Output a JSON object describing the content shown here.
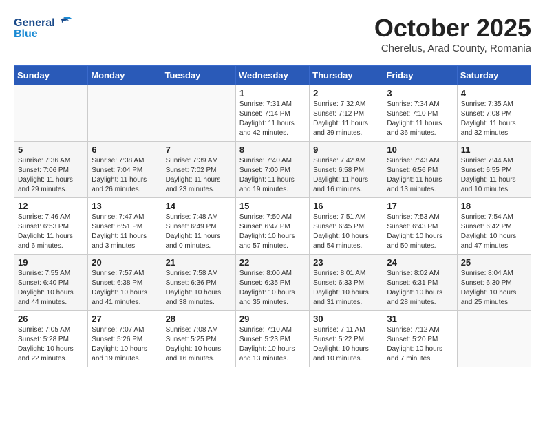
{
  "header": {
    "logo_line1": "General",
    "logo_line2": "Blue",
    "month": "October 2025",
    "location": "Cherelus, Arad County, Romania"
  },
  "weekdays": [
    "Sunday",
    "Monday",
    "Tuesday",
    "Wednesday",
    "Thursday",
    "Friday",
    "Saturday"
  ],
  "weeks": [
    [
      {
        "day": "",
        "info": ""
      },
      {
        "day": "",
        "info": ""
      },
      {
        "day": "",
        "info": ""
      },
      {
        "day": "1",
        "info": "Sunrise: 7:31 AM\nSunset: 7:14 PM\nDaylight: 11 hours\nand 42 minutes."
      },
      {
        "day": "2",
        "info": "Sunrise: 7:32 AM\nSunset: 7:12 PM\nDaylight: 11 hours\nand 39 minutes."
      },
      {
        "day": "3",
        "info": "Sunrise: 7:34 AM\nSunset: 7:10 PM\nDaylight: 11 hours\nand 36 minutes."
      },
      {
        "day": "4",
        "info": "Sunrise: 7:35 AM\nSunset: 7:08 PM\nDaylight: 11 hours\nand 32 minutes."
      }
    ],
    [
      {
        "day": "5",
        "info": "Sunrise: 7:36 AM\nSunset: 7:06 PM\nDaylight: 11 hours\nand 29 minutes."
      },
      {
        "day": "6",
        "info": "Sunrise: 7:38 AM\nSunset: 7:04 PM\nDaylight: 11 hours\nand 26 minutes."
      },
      {
        "day": "7",
        "info": "Sunrise: 7:39 AM\nSunset: 7:02 PM\nDaylight: 11 hours\nand 23 minutes."
      },
      {
        "day": "8",
        "info": "Sunrise: 7:40 AM\nSunset: 7:00 PM\nDaylight: 11 hours\nand 19 minutes."
      },
      {
        "day": "9",
        "info": "Sunrise: 7:42 AM\nSunset: 6:58 PM\nDaylight: 11 hours\nand 16 minutes."
      },
      {
        "day": "10",
        "info": "Sunrise: 7:43 AM\nSunset: 6:56 PM\nDaylight: 11 hours\nand 13 minutes."
      },
      {
        "day": "11",
        "info": "Sunrise: 7:44 AM\nSunset: 6:55 PM\nDaylight: 11 hours\nand 10 minutes."
      }
    ],
    [
      {
        "day": "12",
        "info": "Sunrise: 7:46 AM\nSunset: 6:53 PM\nDaylight: 11 hours\nand 6 minutes."
      },
      {
        "day": "13",
        "info": "Sunrise: 7:47 AM\nSunset: 6:51 PM\nDaylight: 11 hours\nand 3 minutes."
      },
      {
        "day": "14",
        "info": "Sunrise: 7:48 AM\nSunset: 6:49 PM\nDaylight: 11 hours\nand 0 minutes."
      },
      {
        "day": "15",
        "info": "Sunrise: 7:50 AM\nSunset: 6:47 PM\nDaylight: 10 hours\nand 57 minutes."
      },
      {
        "day": "16",
        "info": "Sunrise: 7:51 AM\nSunset: 6:45 PM\nDaylight: 10 hours\nand 54 minutes."
      },
      {
        "day": "17",
        "info": "Sunrise: 7:53 AM\nSunset: 6:43 PM\nDaylight: 10 hours\nand 50 minutes."
      },
      {
        "day": "18",
        "info": "Sunrise: 7:54 AM\nSunset: 6:42 PM\nDaylight: 10 hours\nand 47 minutes."
      }
    ],
    [
      {
        "day": "19",
        "info": "Sunrise: 7:55 AM\nSunset: 6:40 PM\nDaylight: 10 hours\nand 44 minutes."
      },
      {
        "day": "20",
        "info": "Sunrise: 7:57 AM\nSunset: 6:38 PM\nDaylight: 10 hours\nand 41 minutes."
      },
      {
        "day": "21",
        "info": "Sunrise: 7:58 AM\nSunset: 6:36 PM\nDaylight: 10 hours\nand 38 minutes."
      },
      {
        "day": "22",
        "info": "Sunrise: 8:00 AM\nSunset: 6:35 PM\nDaylight: 10 hours\nand 35 minutes."
      },
      {
        "day": "23",
        "info": "Sunrise: 8:01 AM\nSunset: 6:33 PM\nDaylight: 10 hours\nand 31 minutes."
      },
      {
        "day": "24",
        "info": "Sunrise: 8:02 AM\nSunset: 6:31 PM\nDaylight: 10 hours\nand 28 minutes."
      },
      {
        "day": "25",
        "info": "Sunrise: 8:04 AM\nSunset: 6:30 PM\nDaylight: 10 hours\nand 25 minutes."
      }
    ],
    [
      {
        "day": "26",
        "info": "Sunrise: 7:05 AM\nSunset: 5:28 PM\nDaylight: 10 hours\nand 22 minutes."
      },
      {
        "day": "27",
        "info": "Sunrise: 7:07 AM\nSunset: 5:26 PM\nDaylight: 10 hours\nand 19 minutes."
      },
      {
        "day": "28",
        "info": "Sunrise: 7:08 AM\nSunset: 5:25 PM\nDaylight: 10 hours\nand 16 minutes."
      },
      {
        "day": "29",
        "info": "Sunrise: 7:10 AM\nSunset: 5:23 PM\nDaylight: 10 hours\nand 13 minutes."
      },
      {
        "day": "30",
        "info": "Sunrise: 7:11 AM\nSunset: 5:22 PM\nDaylight: 10 hours\nand 10 minutes."
      },
      {
        "day": "31",
        "info": "Sunrise: 7:12 AM\nSunset: 5:20 PM\nDaylight: 10 hours\nand 7 minutes."
      },
      {
        "day": "",
        "info": ""
      }
    ]
  ]
}
